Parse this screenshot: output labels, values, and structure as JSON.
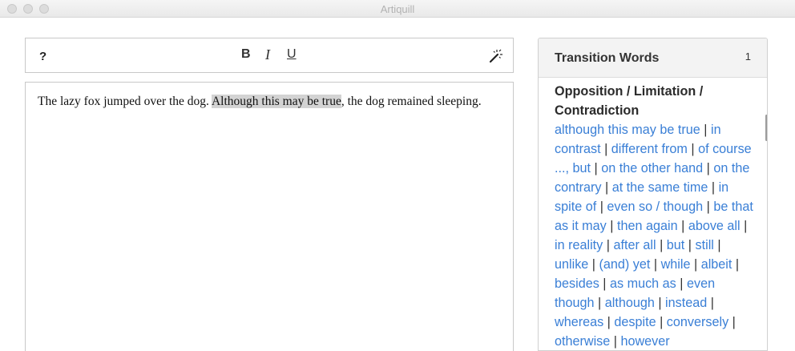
{
  "window": {
    "title": "Artiquill"
  },
  "toolbar": {
    "help_label": "?",
    "bold_label": "B",
    "italic_label": "I",
    "underline_label": "U",
    "magic_wand_icon": "magic-wand-icon"
  },
  "editor": {
    "text_before": "The lazy fox jumped over the dog. ",
    "highlighted": "Although this may be true",
    "text_after": ", the dog remained sleeping."
  },
  "panel": {
    "title": "Transition Words",
    "count": "1",
    "category": "Opposition / Limitation / Contradiction",
    "words": [
      "although this may be true",
      "in contrast",
      "different from",
      "of course ..., but",
      "on the other hand",
      "on the contrary",
      "at the same time",
      "in spite of",
      "even so / though",
      "be that as it may",
      "then again",
      "above all",
      "in reality",
      "after all",
      "but",
      "still",
      "unlike",
      "(and) yet",
      "while",
      "albeit",
      "besides",
      "as much as",
      "even though",
      "although",
      "instead",
      "whereas",
      "despite",
      "conversely",
      "otherwise",
      "however"
    ]
  }
}
